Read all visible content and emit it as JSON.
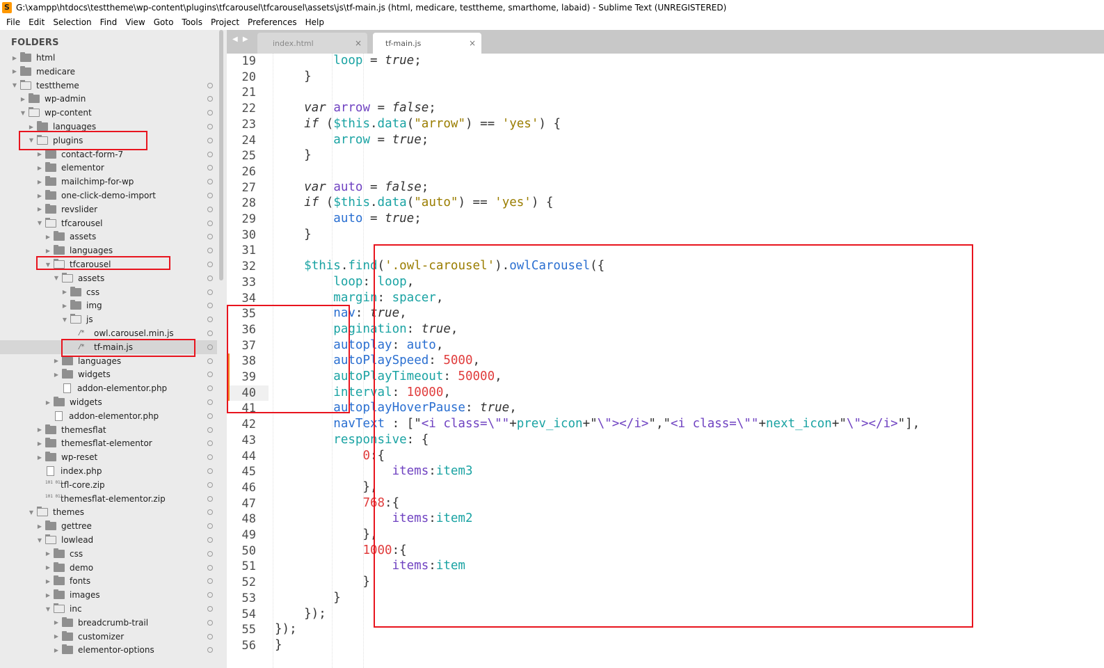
{
  "window": {
    "title": "G:\\xampp\\htdocs\\testtheme\\wp-content\\plugins\\tfcarousel\\tfcarousel\\assets\\js\\tf-main.js (html, medicare, testtheme, smarthome, labaid) - Sublime Text (UNREGISTERED)",
    "app_icon": "S"
  },
  "menu": [
    "File",
    "Edit",
    "Selection",
    "Find",
    "View",
    "Goto",
    "Tools",
    "Project",
    "Preferences",
    "Help"
  ],
  "sidebar": {
    "header": "FOLDERS",
    "items": [
      {
        "label": "html",
        "depth": 0,
        "kind": "folder",
        "expanded": false
      },
      {
        "label": "medicare",
        "depth": 0,
        "kind": "folder",
        "expanded": false
      },
      {
        "label": "testtheme",
        "depth": 0,
        "kind": "folder",
        "expanded": true
      },
      {
        "label": "wp-admin",
        "depth": 1,
        "kind": "folder",
        "expanded": false
      },
      {
        "label": "wp-content",
        "depth": 1,
        "kind": "folder",
        "expanded": true
      },
      {
        "label": "languages",
        "depth": 2,
        "kind": "folder",
        "expanded": false
      },
      {
        "label": "plugins",
        "depth": 2,
        "kind": "folder",
        "expanded": true
      },
      {
        "label": "contact-form-7",
        "depth": 3,
        "kind": "folder",
        "expanded": false
      },
      {
        "label": "elementor",
        "depth": 3,
        "kind": "folder",
        "expanded": false
      },
      {
        "label": "mailchimp-for-wp",
        "depth": 3,
        "kind": "folder",
        "expanded": false
      },
      {
        "label": "one-click-demo-import",
        "depth": 3,
        "kind": "folder",
        "expanded": false
      },
      {
        "label": "revslider",
        "depth": 3,
        "kind": "folder",
        "expanded": false
      },
      {
        "label": "tfcarousel",
        "depth": 3,
        "kind": "folder",
        "expanded": true
      },
      {
        "label": "assets",
        "depth": 4,
        "kind": "folder",
        "expanded": false
      },
      {
        "label": "languages",
        "depth": 4,
        "kind": "folder",
        "expanded": false
      },
      {
        "label": "tfcarousel",
        "depth": 4,
        "kind": "folder",
        "expanded": true
      },
      {
        "label": "assets",
        "depth": 5,
        "kind": "folder",
        "expanded": true
      },
      {
        "label": "css",
        "depth": 6,
        "kind": "folder",
        "expanded": false
      },
      {
        "label": "img",
        "depth": 6,
        "kind": "folder",
        "expanded": false
      },
      {
        "label": "js",
        "depth": 6,
        "kind": "folder",
        "expanded": true
      },
      {
        "label": "owl.carousel.min.js",
        "depth": 7,
        "kind": "js"
      },
      {
        "label": "tf-main.js",
        "depth": 7,
        "kind": "js",
        "selected": true
      },
      {
        "label": "languages",
        "depth": 5,
        "kind": "folder",
        "expanded": false
      },
      {
        "label": "widgets",
        "depth": 5,
        "kind": "folder",
        "expanded": false
      },
      {
        "label": "addon-elementor.php",
        "depth": 5,
        "kind": "file"
      },
      {
        "label": "widgets",
        "depth": 4,
        "kind": "folder",
        "expanded": false
      },
      {
        "label": "addon-elementor.php",
        "depth": 4,
        "kind": "file"
      },
      {
        "label": "themesflat",
        "depth": 3,
        "kind": "folder",
        "expanded": false
      },
      {
        "label": "themesflat-elementor",
        "depth": 3,
        "kind": "folder",
        "expanded": false
      },
      {
        "label": "wp-reset",
        "depth": 3,
        "kind": "folder",
        "expanded": false
      },
      {
        "label": "index.php",
        "depth": 3,
        "kind": "file"
      },
      {
        "label": "tfl-core.zip",
        "depth": 3,
        "kind": "zip"
      },
      {
        "label": "themesflat-elementor.zip",
        "depth": 3,
        "kind": "zip"
      },
      {
        "label": "themes",
        "depth": 2,
        "kind": "folder",
        "expanded": true
      },
      {
        "label": "gettree",
        "depth": 3,
        "kind": "folder",
        "expanded": false
      },
      {
        "label": "lowlead",
        "depth": 3,
        "kind": "folder",
        "expanded": true
      },
      {
        "label": "css",
        "depth": 4,
        "kind": "folder",
        "expanded": false
      },
      {
        "label": "demo",
        "depth": 4,
        "kind": "folder",
        "expanded": false
      },
      {
        "label": "fonts",
        "depth": 4,
        "kind": "folder",
        "expanded": false
      },
      {
        "label": "images",
        "depth": 4,
        "kind": "folder",
        "expanded": false
      },
      {
        "label": "inc",
        "depth": 4,
        "kind": "folder",
        "expanded": true
      },
      {
        "label": "breadcrumb-trail",
        "depth": 5,
        "kind": "folder",
        "expanded": false
      },
      {
        "label": "customizer",
        "depth": 5,
        "kind": "folder",
        "expanded": false
      },
      {
        "label": "elementor-options",
        "depth": 5,
        "kind": "folder",
        "expanded": false
      }
    ]
  },
  "tabs": [
    {
      "label": "index.html",
      "active": false,
      "close": "×"
    },
    {
      "label": "tf-main.js",
      "active": true,
      "close": "×"
    }
  ],
  "tab_nav": "◀ ▶",
  "editor": {
    "current_line": 40,
    "line_numbers": [
      19,
      20,
      21,
      22,
      23,
      24,
      25,
      26,
      27,
      28,
      29,
      30,
      31,
      32,
      33,
      34,
      35,
      36,
      37,
      38,
      39,
      40,
      41,
      42,
      43,
      44,
      45,
      46,
      47,
      48,
      49,
      50,
      51,
      52,
      53,
      54,
      55,
      56
    ],
    "lines": [
      [
        [
          "p",
          "        "
        ],
        [
          "v",
          "loop"
        ],
        [
          "p",
          " = "
        ],
        [
          "k",
          "true"
        ],
        [
          "p",
          ";"
        ]
      ],
      [
        [
          "p",
          "    }"
        ]
      ],
      [
        [
          "p",
          ""
        ]
      ],
      [
        [
          "p",
          "    "
        ],
        [
          "k",
          "var"
        ],
        [
          "p",
          " "
        ],
        [
          "t",
          "arrow"
        ],
        [
          "p",
          " = "
        ],
        [
          "k",
          "false"
        ],
        [
          "p",
          ";"
        ]
      ],
      [
        [
          "p",
          "    "
        ],
        [
          "k",
          "if"
        ],
        [
          "p",
          " ("
        ],
        [
          "v",
          "$this"
        ],
        [
          "p",
          "."
        ],
        [
          "v",
          "data"
        ],
        [
          "p",
          "("
        ],
        [
          "s",
          "\"arrow\""
        ],
        [
          "p",
          ") == "
        ],
        [
          "s",
          "'yes'"
        ],
        [
          "p",
          ") {"
        ]
      ],
      [
        [
          "p",
          "        "
        ],
        [
          "v",
          "arrow"
        ],
        [
          "p",
          " = "
        ],
        [
          "k",
          "true"
        ],
        [
          "p",
          ";"
        ]
      ],
      [
        [
          "p",
          "    }"
        ]
      ],
      [
        [
          "p",
          ""
        ]
      ],
      [
        [
          "p",
          "    "
        ],
        [
          "k",
          "var"
        ],
        [
          "p",
          " "
        ],
        [
          "t",
          "auto"
        ],
        [
          "p",
          " = "
        ],
        [
          "k",
          "false"
        ],
        [
          "p",
          ";"
        ]
      ],
      [
        [
          "p",
          "    "
        ],
        [
          "k",
          "if"
        ],
        [
          "p",
          " ("
        ],
        [
          "v",
          "$this"
        ],
        [
          "p",
          "."
        ],
        [
          "v",
          "data"
        ],
        [
          "p",
          "("
        ],
        [
          "s",
          "\"auto\""
        ],
        [
          "p",
          ") == "
        ],
        [
          "s",
          "'yes'"
        ],
        [
          "p",
          ") {"
        ]
      ],
      [
        [
          "p",
          "        "
        ],
        [
          "b",
          "auto"
        ],
        [
          "p",
          " = "
        ],
        [
          "k",
          "true"
        ],
        [
          "p",
          ";"
        ]
      ],
      [
        [
          "p",
          "    }"
        ]
      ],
      [
        [
          "p",
          ""
        ]
      ],
      [
        [
          "p",
          "    "
        ],
        [
          "v",
          "$this"
        ],
        [
          "p",
          "."
        ],
        [
          "v",
          "find"
        ],
        [
          "p",
          "("
        ],
        [
          "s",
          "'.owl-carousel'"
        ],
        [
          "p",
          ")."
        ],
        [
          "b",
          "owlCarousel"
        ],
        [
          "p",
          "({"
        ]
      ],
      [
        [
          "p",
          "        "
        ],
        [
          "v",
          "loop"
        ],
        [
          "p",
          ": "
        ],
        [
          "v",
          "loop"
        ],
        [
          "p",
          ","
        ]
      ],
      [
        [
          "p",
          "        "
        ],
        [
          "v",
          "margin"
        ],
        [
          "p",
          ": "
        ],
        [
          "v",
          "spacer"
        ],
        [
          "p",
          ","
        ]
      ],
      [
        [
          "p",
          "        "
        ],
        [
          "b",
          "nav"
        ],
        [
          "p",
          ": "
        ],
        [
          "k",
          "true"
        ],
        [
          "p",
          ","
        ]
      ],
      [
        [
          "p",
          "        "
        ],
        [
          "v",
          "pagination"
        ],
        [
          "p",
          ": "
        ],
        [
          "k",
          "true"
        ],
        [
          "p",
          ","
        ]
      ],
      [
        [
          "p",
          "        "
        ],
        [
          "b",
          "autoplay"
        ],
        [
          "p",
          ": "
        ],
        [
          "b",
          "auto"
        ],
        [
          "p",
          ","
        ]
      ],
      [
        [
          "p",
          "        "
        ],
        [
          "b",
          "autoPlaySpeed"
        ],
        [
          "p",
          ": "
        ],
        [
          "n",
          "5000"
        ],
        [
          "p",
          ","
        ]
      ],
      [
        [
          "p",
          "        "
        ],
        [
          "v",
          "autoPlayTimeout"
        ],
        [
          "p",
          ": "
        ],
        [
          "n",
          "50000"
        ],
        [
          "p",
          ","
        ]
      ],
      [
        [
          "p",
          "        "
        ],
        [
          "v",
          "interval"
        ],
        [
          "p",
          ": "
        ],
        [
          "n",
          "10000"
        ],
        [
          "p",
          ","
        ]
      ],
      [
        [
          "p",
          "        "
        ],
        [
          "b",
          "autoplayHoverPause"
        ],
        [
          "p",
          ": "
        ],
        [
          "k",
          "true"
        ],
        [
          "p",
          ","
        ]
      ],
      [
        [
          "p",
          "        "
        ],
        [
          "b",
          "navText"
        ],
        [
          "p",
          " : [\""
        ],
        [
          "t",
          "<i class=\\\"\""
        ],
        [
          "p",
          "+"
        ],
        [
          "v",
          "prev_icon"
        ],
        [
          "p",
          "+\""
        ],
        [
          "t",
          "\\\"></i>"
        ],
        [
          "p",
          "\",\""
        ],
        [
          "t",
          "<i class=\\\"\""
        ],
        [
          "p",
          "+"
        ],
        [
          "v",
          "next_icon"
        ],
        [
          "p",
          "+\""
        ],
        [
          "t",
          "\\\"></i>"
        ],
        [
          "p",
          "\"],"
        ]
      ],
      [
        [
          "p",
          "        "
        ],
        [
          "v",
          "responsive"
        ],
        [
          "p",
          ": {"
        ]
      ],
      [
        [
          "p",
          "            "
        ],
        [
          "n",
          "0"
        ],
        [
          "p",
          ":{"
        ]
      ],
      [
        [
          "p",
          "                "
        ],
        [
          "t",
          "items"
        ],
        [
          "p",
          ":"
        ],
        [
          "v",
          "item3"
        ]
      ],
      [
        [
          "p",
          "            },"
        ]
      ],
      [
        [
          "p",
          "            "
        ],
        [
          "n",
          "768"
        ],
        [
          "p",
          ":{"
        ]
      ],
      [
        [
          "p",
          "                "
        ],
        [
          "t",
          "items"
        ],
        [
          "p",
          ":"
        ],
        [
          "v",
          "item2"
        ]
      ],
      [
        [
          "p",
          "            },"
        ]
      ],
      [
        [
          "p",
          "            "
        ],
        [
          "n",
          "1000"
        ],
        [
          "p",
          ":{"
        ]
      ],
      [
        [
          "p",
          "                "
        ],
        [
          "t",
          "items"
        ],
        [
          "p",
          ":"
        ],
        [
          "v",
          "item"
        ]
      ],
      [
        [
          "p",
          "            }"
        ]
      ],
      [
        [
          "p",
          "        }"
        ]
      ],
      [
        [
          "p",
          "    });"
        ]
      ],
      [
        [
          "p",
          "});"
        ]
      ],
      [
        [
          "p",
          "}"
        ]
      ]
    ]
  },
  "colors": {
    "annotation_red": "#e8141e",
    "sidebar_bg": "#ebebeb",
    "tabbar_bg": "#c8c8c8"
  }
}
